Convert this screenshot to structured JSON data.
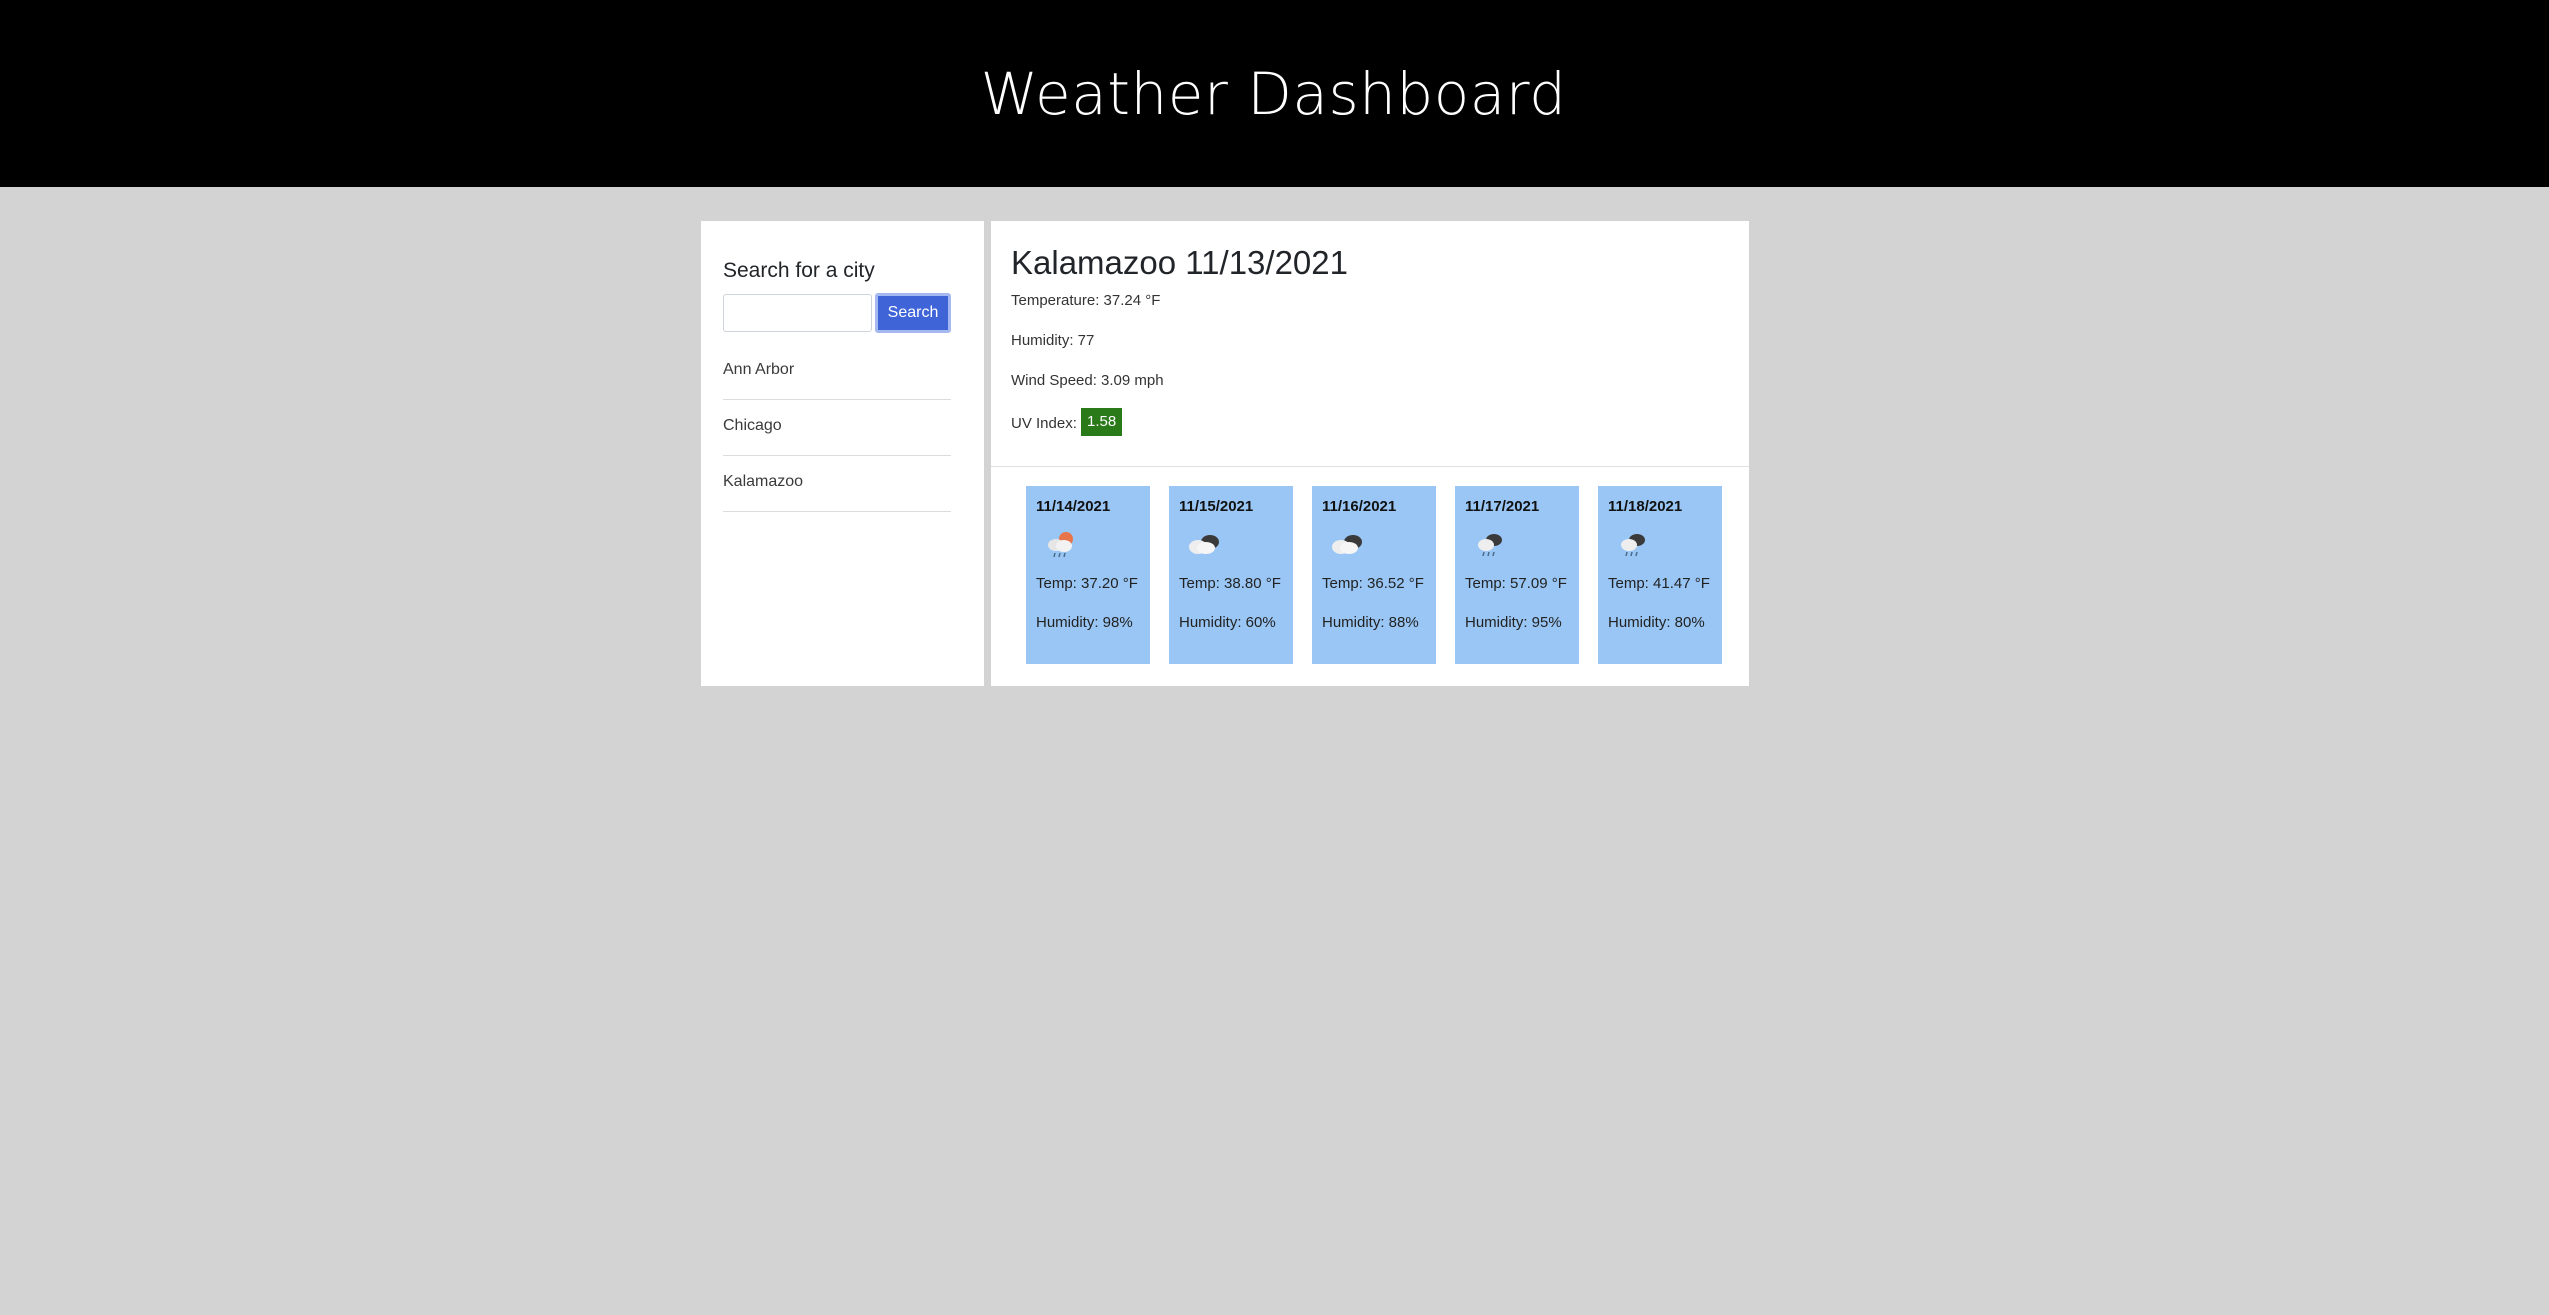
{
  "header": {
    "title": "Weather Dashboard"
  },
  "sidebar": {
    "title": "Search for a city",
    "search_placeholder": "",
    "search_button": "Search",
    "cities": [
      "Ann Arbor",
      "Chicago",
      "Kalamazoo"
    ]
  },
  "current": {
    "heading": "Kalamazoo 11/13/2021",
    "temperature": "Temperature: 37.24 °F",
    "humidity": "Humidity: 77",
    "wind": "Wind Speed: 3.09 mph",
    "uv_label": "UV Index: ",
    "uv_value": "1.58",
    "uv_color": "#2a7a1a"
  },
  "forecast": [
    {
      "date": "11/14/2021",
      "icon": "sun-cloud-rain-icon",
      "temp": "Temp: 37.20 °F",
      "humidity": "Humidity: 98%"
    },
    {
      "date": "11/15/2021",
      "icon": "broken-clouds-icon",
      "temp": "Temp: 38.80 °F",
      "humidity": "Humidity: 60%"
    },
    {
      "date": "11/16/2021",
      "icon": "broken-clouds-icon",
      "temp": "Temp: 36.52 °F",
      "humidity": "Humidity: 88%"
    },
    {
      "date": "11/17/2021",
      "icon": "cloud-rain-icon",
      "temp": "Temp: 57.09 °F",
      "humidity": "Humidity: 95%"
    },
    {
      "date": "11/18/2021",
      "icon": "cloud-rain-icon",
      "temp": "Temp: 41.47 °F",
      "humidity": "Humidity: 80%"
    }
  ],
  "colors": {
    "header_bg": "#000000",
    "page_bg": "#d3d3d3",
    "card_bg": "#99c6f5",
    "button_bg": "#3f64d8"
  }
}
